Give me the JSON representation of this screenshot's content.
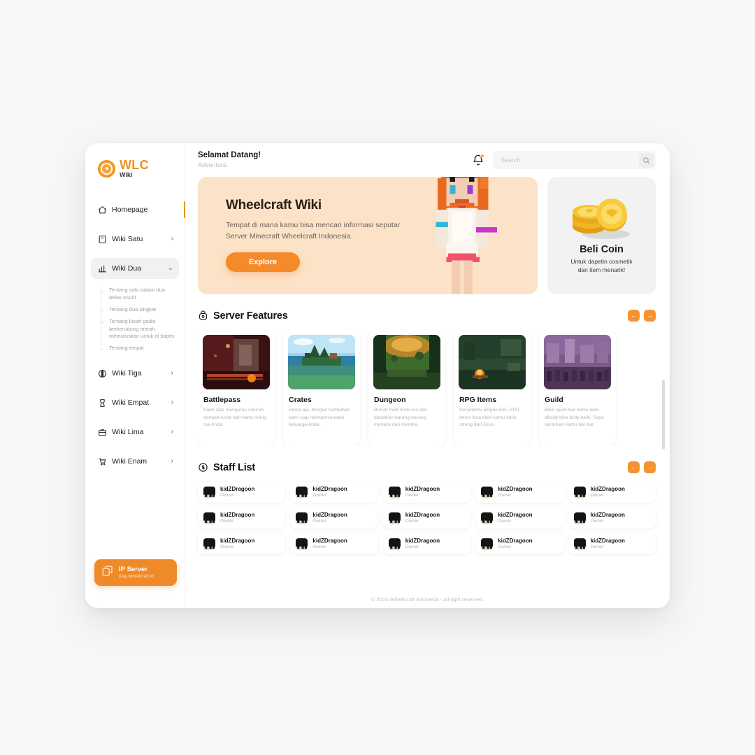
{
  "theme": {
    "accent": "#f0901f",
    "accent_button": "#f58a2a",
    "hero_bg": "#fce3c8",
    "coin_card_bg": "#f2f2f2",
    "page_bg": "#f7f7f7"
  },
  "sidebar": {
    "brand": {
      "title": "WLC",
      "subtitle": "Wiki",
      "icon": "wheel-logo-icon"
    },
    "items": [
      {
        "label": "Homepage",
        "icon": "home-icon",
        "chevron": "",
        "active": true,
        "expandable": false
      },
      {
        "label": "Wiki Satu",
        "icon": "bookmark-icon",
        "chevron": "›",
        "active": false,
        "expandable": true
      },
      {
        "label": "Wiki Dua",
        "icon": "chart-bar-icon",
        "chevron": "⌄",
        "active": false,
        "expandable": true
      },
      {
        "label": "Wiki Tiga",
        "icon": "contrast-icon",
        "chevron": "›",
        "active": false,
        "expandable": true
      },
      {
        "label": "Wiki Empat",
        "icon": "trophy-icon",
        "chevron": "›",
        "active": false,
        "expandable": true
      },
      {
        "label": "Wiki Lima",
        "icon": "briefcase-icon",
        "chevron": "›",
        "active": false,
        "expandable": true
      },
      {
        "label": "Wiki Enam",
        "icon": "cart-icon",
        "chevron": "›",
        "active": false,
        "expandable": true
      }
    ],
    "sub_items": [
      "Tentang satu dalam dua belas murid",
      "Tentang dua singkat",
      "Tentang kisah gadis berkerudung merah memutuskan untuk di baptis",
      "Tentang empat"
    ],
    "ip_server": {
      "title": "IP Server",
      "address": "play.wheelcraft.id",
      "icon": "copy-icon"
    }
  },
  "topbar": {
    "greeting_title": "Selamat Datang!",
    "greeting_sub": "Adventure.",
    "bell_icon": "bell-icon",
    "search_placeholder": "Search",
    "search_value": "",
    "search_icon": "search-icon"
  },
  "hero": {
    "title": "Wheelcraft Wiki",
    "description": "Tempat di mana kamu bisa mencari informasi seputar Server Minecraft Wheelcraft Indonesia.",
    "cta_label": "Explore",
    "character_alt": "minecraft-character"
  },
  "coin_card": {
    "title": "Beli Coin",
    "subtitle_line1": "Untuk dapetin cosmetik",
    "subtitle_line2": "dan item menarik!",
    "art": "gold-coins-icon"
  },
  "server_features": {
    "heading": "Server Features",
    "icon": "lock-circle-icon",
    "prev_label": "←",
    "next_label": "→",
    "cards": [
      {
        "title": "Battlepass",
        "desc": "Kami siap menguras seluruh dompet Anda dan harta orang tua Anda.",
        "thumb": "nether-railway-thumb"
      },
      {
        "title": "Crates",
        "desc": "Sama aja, dengan tambahan kami siap mempersenjatai keluarga Anda.",
        "thumb": "island-lake-thumb"
      },
      {
        "title": "Dungeon",
        "desc": "Bunuh mob-mob usk dan dapatkan barang-barang menarik dari mereka.",
        "thumb": "forest-dungeon-thumb"
      },
      {
        "title": "RPG Items",
        "desc": "Senjatamu ampas dek, RPG Items bisa bikin kamu lebih strong dari Zeus.",
        "thumb": "campfire-night-thumb"
      },
      {
        "title": "Guild",
        "desc": "Bikin guild biar kamu kalo dibully bisa bully balik. Saya sarankan kamu bar-bar.",
        "thumb": "castle-crowd-thumb"
      }
    ]
  },
  "staff_list": {
    "heading": "Staff List",
    "icon": "badge-circle-icon",
    "prev_label": "←",
    "next_label": "→",
    "members": [
      {
        "name": "kidZDragoon",
        "role": "Owner"
      },
      {
        "name": "kidZDragoon",
        "role": "Owner"
      },
      {
        "name": "kidZDragoon",
        "role": "Owner"
      },
      {
        "name": "kidZDragoon",
        "role": "Owner"
      },
      {
        "name": "kidZDragoon",
        "role": "Owner"
      },
      {
        "name": "kidZDragoon",
        "role": "Owner"
      },
      {
        "name": "kidZDragoon",
        "role": "Owner"
      },
      {
        "name": "kidZDragoon",
        "role": "Owner"
      },
      {
        "name": "kidZDragoon",
        "role": "Owner"
      },
      {
        "name": "kidZDragoon",
        "role": "Owner"
      },
      {
        "name": "kidZDragoon",
        "role": "Owner"
      },
      {
        "name": "kidZDragoon",
        "role": "Owner"
      },
      {
        "name": "kidZDragoon",
        "role": "Owner"
      },
      {
        "name": "kidZDragoon",
        "role": "Owner"
      },
      {
        "name": "kidZDragoon",
        "role": "Owner"
      }
    ]
  },
  "footer": {
    "text": "© 2023 Wheelcraft Indonesia - All right reserved."
  }
}
